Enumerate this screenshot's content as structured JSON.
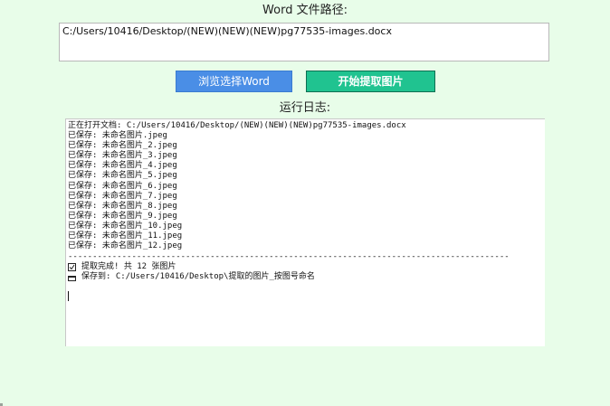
{
  "word_path": {
    "label": "Word 文件路径:",
    "value": "C:/Users/10416/Desktop/(NEW)(NEW)(NEW)pg77535-images.docx"
  },
  "buttons": {
    "browse_label": "浏览选择Word",
    "extract_label": "开始提取图片"
  },
  "log": {
    "label": "运行日志:",
    "lines": [
      "正在打开文档: C:/Users/10416/Desktop/(NEW)(NEW)(NEW)pg77535-images.docx",
      "已保存: 未命名图片.jpeg",
      "已保存: 未命名图片_2.jpeg",
      "已保存: 未命名图片_3.jpeg",
      "已保存: 未命名图片_4.jpeg",
      "已保存: 未命名图片_5.jpeg",
      "已保存: 未命名图片_6.jpeg",
      "已保存: 未命名图片_7.jpeg",
      "已保存: 未命名图片_8.jpeg",
      "已保存: 未命名图片_9.jpeg",
      "已保存: 未命名图片_10.jpeg",
      "已保存: 未命名图片_11.jpeg",
      "已保存: 未命名图片_12.jpeg"
    ],
    "separator": "------------------------------------------------------------------------------------------",
    "done_text": "提取完成! 共 12 张图片",
    "saved_to_text": "保存到: C:/Users/10416/Desktop\\提取的图片_按图号命名",
    "done_icon": "check-box-icon",
    "saved_icon": "folder-icon"
  },
  "colors": {
    "background": "#e8fde9",
    "browse_button": "#4a8ee6",
    "extract_button": "#20c390"
  }
}
